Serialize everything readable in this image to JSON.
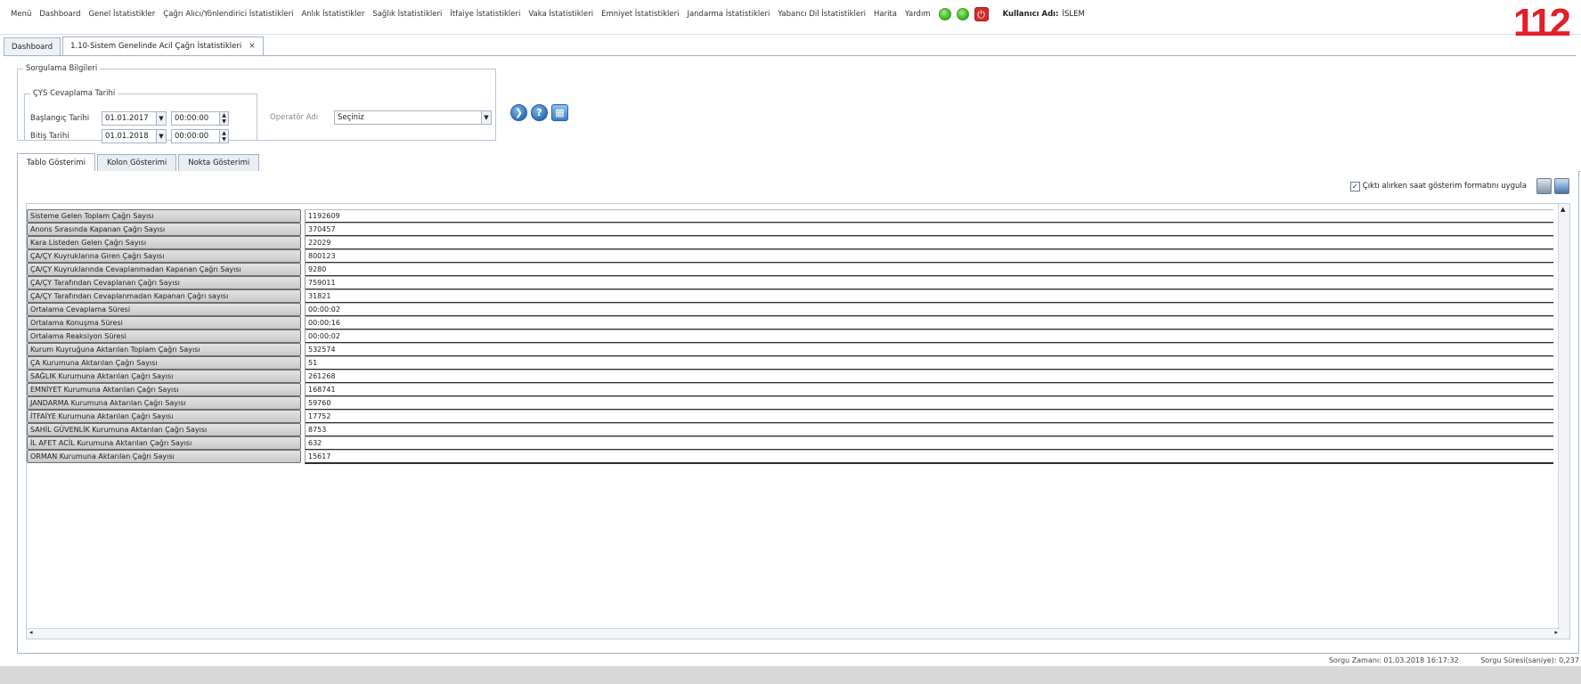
{
  "menu": {
    "items": [
      "Menü",
      "Dashboard",
      "Genel İstatistikler",
      "Çağrı Alıcı/Yönlendirici İstatistikleri",
      "Anlık İstatistikler",
      "Sağlık İstatistikleri",
      "İtfaiye İstatistikleri",
      "Vaka İstatistikleri",
      "Emniyet İstatistikleri",
      "Jandarma İstatistikleri",
      "Yabancı Dil İstatistikleri",
      "Harita",
      "Yardım"
    ],
    "user_label": "Kullanıcı Adı:",
    "user_value": "İSLEM"
  },
  "logo": {
    "text": "112",
    "color": "#e21f2b"
  },
  "doc_tabs": [
    {
      "label": "Dashboard"
    },
    {
      "label": "1.10-Sistem Genelinde Acil Çağrı İstatistikleri",
      "close": "×"
    }
  ],
  "query": {
    "legend": "Sorgulama Bilgileri",
    "cys_legend": "ÇYS Cevaplama Tarihi",
    "start_label": "Başlangıç Tarihi",
    "start_date": "01.01.2017",
    "start_time": "00:00:00",
    "end_label": "Bitiş Tarihi",
    "end_date": "01.01.2018",
    "end_time": "00:00:00",
    "operator_label": "Operatör Adı",
    "operator_value": "Seçiniz"
  },
  "result_tabs": [
    "Tablo Gösterimi",
    "Kolon Gösterimi",
    "Nokta Gösterimi"
  ],
  "options": {
    "checkbox_label": "Çıktı alırken saat gösterim formatını uygula",
    "checked": "✓"
  },
  "rows": [
    {
      "label": "Sisteme Gelen Toplam Çağrı Sayısı",
      "value": "1192609"
    },
    {
      "label": "Anons Sırasında Kapanan Çağrı Sayısı",
      "value": "370457"
    },
    {
      "label": "Kara Listeden Gelen Çağrı Sayısı",
      "value": "22029"
    },
    {
      "label": "ÇA/ÇY Kuyruklarına Giren Çağrı Sayısı",
      "value": "800123"
    },
    {
      "label": "ÇA/ÇY Kuyruklarında Cevaplanmadan Kapanan Çağrı Sayısı",
      "value": "9280"
    },
    {
      "label": "ÇA/ÇY Tarafından Cevaplanan Çağrı Sayısı",
      "value": "759011"
    },
    {
      "label": "ÇA/ÇY Tarafından Cevaplanmadan Kapanan Çağrı sayısı",
      "value": "31821"
    },
    {
      "label": "Ortalama Cevaplama Süresi",
      "value": "00:00:02"
    },
    {
      "label": "Ortalama Konuşma Süresi",
      "value": "00:00:16"
    },
    {
      "label": "Ortalama Reaksiyon Süresi",
      "value": "00:00:02"
    },
    {
      "label": "Kurum Kuyruğuna Aktarılan Toplam Çağrı Sayısı",
      "value": "532574"
    },
    {
      "label": "ÇA Kurumuna Aktarılan Çağrı Sayısı",
      "value": "51"
    },
    {
      "label": "SAĞLIK Kurumuna Aktarılan Çağrı Sayısı",
      "value": "261268"
    },
    {
      "label": "EMNİYET Kurumuna Aktarılan Çağrı Sayısı",
      "value": "168741"
    },
    {
      "label": "JANDARMA Kurumuna Aktarılan Çağrı Sayısı",
      "value": "59760"
    },
    {
      "label": "İTFAİYE Kurumuna Aktarılan Çağrı Sayısı",
      "value": "17752"
    },
    {
      "label": "SAHİL GÜVENLİK Kurumuna Aktarılan Çağrı Sayısı",
      "value": "8753"
    },
    {
      "label": "İL AFET ACİL Kurumuna Aktarılan Çağrı Sayısı",
      "value": "632"
    },
    {
      "label": "ORMAN Kurumuna Aktarılan Çağrı Sayısı",
      "value": "15617"
    }
  ],
  "footer": {
    "query_time": "Sorgu Zamanı: 01.03.2018 16:17:32",
    "query_duration": "Sorgu Süresi(saniye): 0,237"
  }
}
